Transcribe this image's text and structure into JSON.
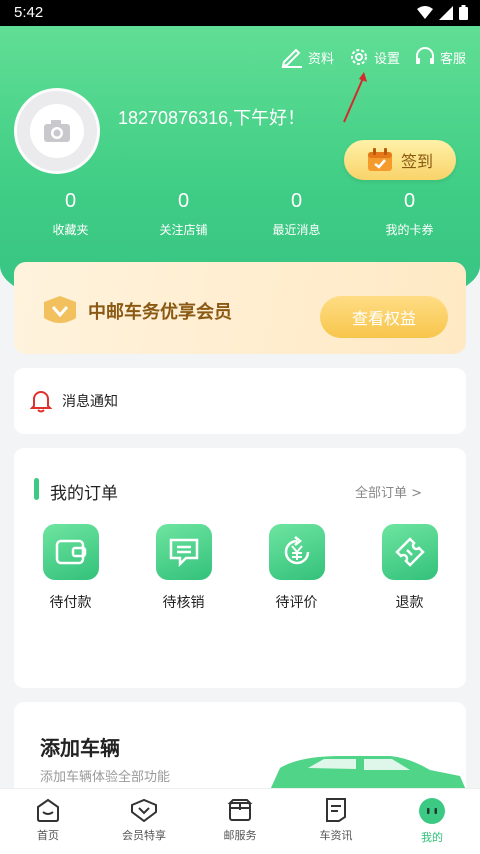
{
  "status_bar": {
    "time": "5:42"
  },
  "header": {
    "actions": [
      {
        "label": "资料",
        "icon": "edit-icon"
      },
      {
        "label": "设置",
        "icon": "gear-icon"
      },
      {
        "label": "客服",
        "icon": "headset-icon"
      }
    ]
  },
  "user": {
    "greeting": "18270876316,下午好！"
  },
  "sign_in": {
    "label": "签到"
  },
  "stats": [
    {
      "value": "0",
      "label": "收藏夹"
    },
    {
      "value": "0",
      "label": "关注店铺"
    },
    {
      "value": "0",
      "label": "最近消息"
    },
    {
      "value": "0",
      "label": "我的卡券"
    }
  ],
  "member": {
    "title": "中邮车务优享会员",
    "button": "查看权益"
  },
  "notice": {
    "label": "消息通知"
  },
  "orders": {
    "title": "我的订单",
    "all_link": "全部订单 >",
    "items": [
      {
        "label": "待付款",
        "icon": "wallet-icon"
      },
      {
        "label": "待核销",
        "icon": "message-icon"
      },
      {
        "label": "待评价",
        "icon": "yuan-refresh-icon"
      },
      {
        "label": "退款",
        "icon": "ticket-icon"
      }
    ]
  },
  "vehicle": {
    "title": "添加车辆",
    "subtitle": "添加车辆体验全部功能"
  },
  "tabs": [
    {
      "label": "首页",
      "icon": "home-icon"
    },
    {
      "label": "会员特享",
      "icon": "member-icon"
    },
    {
      "label": "邮服务",
      "icon": "box-icon"
    },
    {
      "label": "车资讯",
      "icon": "news-icon"
    },
    {
      "label": "我的",
      "icon": "profile-icon"
    }
  ],
  "colors": {
    "brand_green": "#3fcd85",
    "gold": "#f7c54b",
    "alert_red": "#e0302e"
  }
}
